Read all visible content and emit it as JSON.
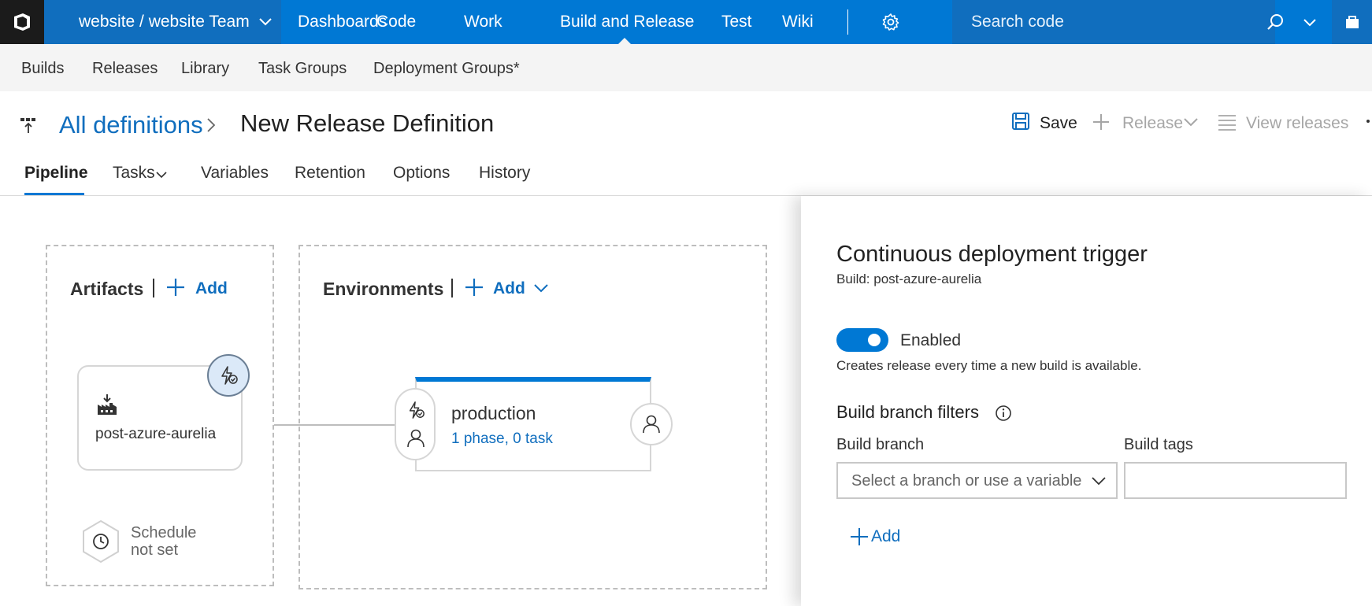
{
  "topbar": {
    "project": "website / website Team",
    "nav": [
      "Dashboards",
      "Code",
      "Work",
      "Build and Release",
      "Test",
      "Wiki"
    ],
    "active_nav": "Build and Release",
    "search_placeholder": "Search code",
    "accent": "#0078d4"
  },
  "subnav": {
    "items": [
      "Builds",
      "Releases",
      "Library",
      "Task Groups",
      "Deployment Groups*"
    ]
  },
  "title": {
    "breadcrumb": "All definitions",
    "page_title": "New Release Definition",
    "save": "Save",
    "release": "Release",
    "view_releases": "View releases"
  },
  "tabs": {
    "items": [
      "Pipeline",
      "Tasks",
      "Variables",
      "Retention",
      "Options",
      "History"
    ],
    "active": "Pipeline"
  },
  "pipeline": {
    "artifacts_title": "Artifacts",
    "artifacts_add": "Add",
    "artifact_name": "post-azure-aurelia",
    "schedule_line1": "Schedule",
    "schedule_line2": "not set",
    "environments_title": "Environments",
    "environments_add": "Add",
    "env_name": "production",
    "env_summary": "1 phase, 0 task"
  },
  "panel": {
    "title": "Continuous deployment trigger",
    "subtitle": "Build: post-azure-aurelia",
    "toggle_enabled": true,
    "toggle_label": "Enabled",
    "toggle_desc": "Creates release every time a new build is available.",
    "filters_title": "Build branch filters",
    "branch_label": "Build branch",
    "branch_placeholder": "Select a branch or use a variable",
    "tags_label": "Build tags",
    "add_label": "Add"
  }
}
